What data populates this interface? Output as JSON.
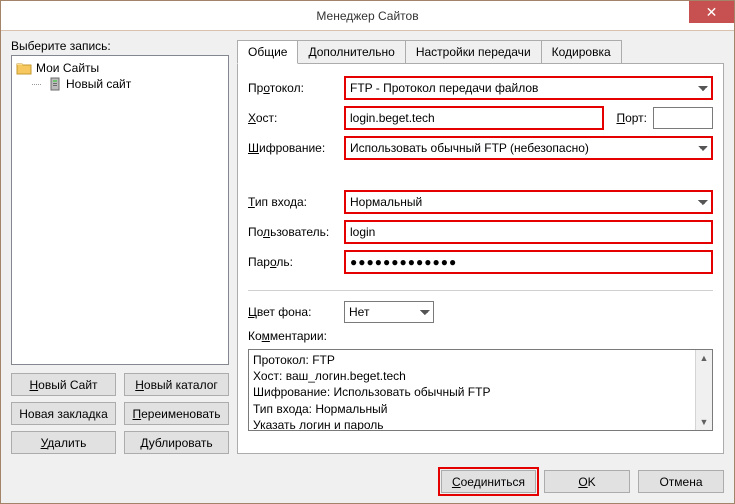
{
  "window": {
    "title": "Менеджер Сайтов"
  },
  "left": {
    "select_label": "Выберите запись:",
    "tree": {
      "root": "Мои Сайты",
      "child": "Новый сайт"
    },
    "buttons": {
      "new_site_pre": "Н",
      "new_site_rest": "овый Сайт",
      "new_folder_pre": "Н",
      "new_folder_rest": "овый каталог",
      "new_bookmark_pre": "",
      "new_bookmark_rest": "Новая закладка",
      "rename_pre": "П",
      "rename_rest": "ереименовать",
      "delete_pre": "У",
      "delete_rest": "далить",
      "duplicate_pre": "Д",
      "duplicate_rest": "ублировать"
    }
  },
  "tabs": {
    "general": "Общие",
    "advanced": "Дополнительно",
    "transfer": "Настройки передачи",
    "charset": "Кодировка"
  },
  "form": {
    "protocol_label_pre": "Пр",
    "protocol_label_und": "о",
    "protocol_label_post": "токол:",
    "protocol_value": "FTP - Протокол передачи файлов",
    "host_label_pre": "",
    "host_label_und": "Х",
    "host_label_post": "ост:",
    "host_value": "login.beget.tech",
    "port_label_pre": "",
    "port_label_und": "П",
    "port_label_post": "орт:",
    "port_value": "",
    "encryption_label_pre": "",
    "encryption_label_und": "Ш",
    "encryption_label_post": "ифрование:",
    "encryption_value": "Использовать обычный FTP (небезопасно)",
    "logon_label_pre": "",
    "logon_label_und": "Т",
    "logon_label_post": "ип входа:",
    "logon_value": "Нормальный",
    "user_label_pre": "По",
    "user_label_und": "л",
    "user_label_post": "ьзователь:",
    "user_value": "login",
    "pass_label_pre": "Пар",
    "pass_label_und": "о",
    "pass_label_post": "ль:",
    "pass_value": "●●●●●●●●●●●●●",
    "bgcolor_label_pre": "",
    "bgcolor_label_und": "Ц",
    "bgcolor_label_post": "вет фона:",
    "bgcolor_value": "Нет",
    "comments_label_pre": "Ко",
    "comments_label_und": "м",
    "comments_label_post": "ментарии:",
    "comments_lines": [
      "Протокол: FTP",
      "Хост: ваш_логин.beget.tech",
      "Шифрование: Использовать обычный FTP",
      "Тип входа: Нормальный",
      "Указать логин и пароль"
    ]
  },
  "footer": {
    "connect_pre": "",
    "connect_und": "С",
    "connect_post": "оединиться",
    "ok": "OK",
    "cancel": "Отмена"
  }
}
